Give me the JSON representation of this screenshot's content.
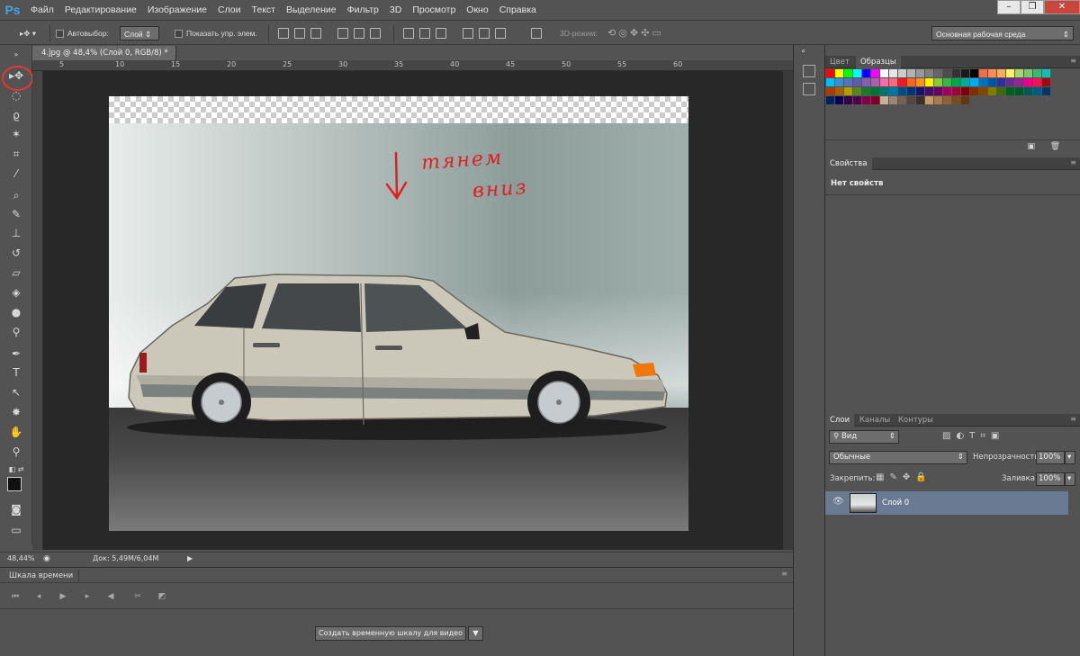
{
  "app": {
    "logo": "Ps"
  },
  "menu": [
    "Файл",
    "Редактирование",
    "Изображение",
    "Слои",
    "Текст",
    "Выделение",
    "Фильтр",
    "3D",
    "Просмотр",
    "Окно",
    "Справка"
  ],
  "window_controls": {
    "minimize": "–",
    "maximize": "❐",
    "close": "✕"
  },
  "options": {
    "autoselect_label": "Автовыбор:",
    "autoselect_value": "Слой",
    "show_transform_label": "Показать упр. элем.",
    "mode3d_label": "3D-режим:",
    "workspace": "Основная рабочая среда"
  },
  "document": {
    "tab_title": "4.jpg @ 48,4% (Слой 0, RGB/8) *",
    "ruler_ticks": [
      "5",
      "10",
      "15",
      "20",
      "25",
      "30",
      "35",
      "40",
      "45",
      "50",
      "55",
      "60"
    ],
    "annotation_line1": "тянем",
    "annotation_line2": "вниз"
  },
  "status": {
    "zoom": "48,44%",
    "doc_size": "Док: 5,49M/6,04M"
  },
  "timeline": {
    "tab": "Шкала времени",
    "create_button": "Создать временную шкалу для видео"
  },
  "panels": {
    "color_tab": "Цвет",
    "swatches_tab": "Образцы",
    "properties_tab": "Свойства",
    "properties_empty": "Нет свойств",
    "layers_tab": "Слои",
    "channels_tab": "Каналы",
    "paths_tab": "Контуры",
    "filter_kind": "Вид",
    "blend_mode": "Обычные",
    "opacity_label": "Непрозрачность:",
    "opacity_value": "100%",
    "lock_label": "Закрепить:",
    "fill_label": "Заливка:",
    "fill_value": "100%",
    "layer_name": "Слой 0"
  },
  "colors": {
    "highlight_circle": "#e33333",
    "annotation": "#e02020",
    "layer_selected": "#6b7a93"
  }
}
